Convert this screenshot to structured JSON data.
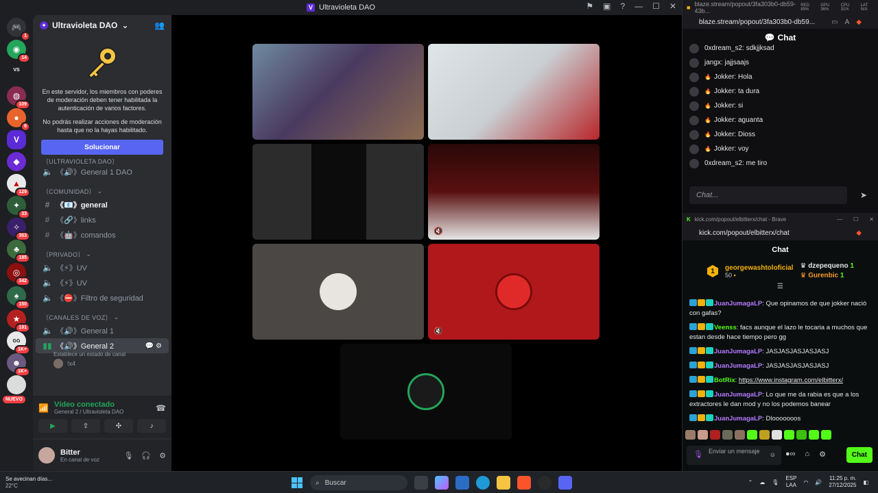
{
  "discord": {
    "window_title": "Ultravioleta DAO",
    "server_name": "Ultravioleta DAO",
    "guild_badges": [
      "1",
      "14",
      "109",
      "6",
      "129",
      "33",
      "353",
      "185",
      "342",
      "150",
      "191",
      "1K+",
      "1K+"
    ],
    "nuevo_label": "NUEVO",
    "mfa_text_1": "En este servidor, los miembros con poderes de moderación deben tener habilitada la autenticación de varios factores.",
    "mfa_text_2": "No podrás realizar acciones de moderación hasta que no la hayas habilitado.",
    "solve_button": "Solucionar",
    "categories": {
      "ultravioleta": "〔ULTRAVIOLETA DAO〕",
      "comunidad": "〔COMUNIDAD〕",
      "privado": "〔PRIVADO〕",
      "voz": "〔CANALES DE VOZ〕"
    },
    "channels": {
      "general1dao": "《🔊》General 1 DAO",
      "general": "《📧》general",
      "links": "《🔗》links",
      "comandos": "《🤖》comandos",
      "uv1": "《⚡》UV",
      "uv2": "《⚡》UV",
      "filtro": "《⛔》Filtro de seguridad",
      "general1": "《🔊》General 1",
      "general2": "《🔊》General 2"
    },
    "channel_status": "Establece un estado de canal",
    "voice_user": "!x4",
    "video_connected": "Vídeo conectado",
    "video_location": "General 2 / Ultravioleta DAO",
    "user_name": "Bitter",
    "user_status": "En canal de voz"
  },
  "blaze": {
    "tab_url": "blaze.stream/popout/3fa303b0-db59-43b...",
    "url": "blaze.stream/popout/3fa303b0-db59...",
    "stats": [
      "RED 85%",
      "GPU 36%",
      "CPU 31%",
      "LAT N/A"
    ],
    "chat_title": "Chat",
    "messages": [
      {
        "user": "0xdream_s2",
        "text": "sdkjjksad",
        "icon": ""
      },
      {
        "user": "jangx",
        "text": "jajjsaajs",
        "icon": ""
      },
      {
        "user": "Jokker",
        "text": "Hola",
        "icon": "🔥"
      },
      {
        "user": "Jokker",
        "text": "ta dura",
        "icon": "🔥"
      },
      {
        "user": "Jokker",
        "text": "si",
        "icon": "🔥"
      },
      {
        "user": "Jokker",
        "text": "aguanta",
        "icon": "🔥"
      },
      {
        "user": "Jokker",
        "text": "Dioss",
        "icon": "🔥"
      },
      {
        "user": "Jokker",
        "text": "voy",
        "icon": "🔥"
      },
      {
        "user": "0xdream_s2",
        "text": "me tiro",
        "icon": ""
      }
    ],
    "input_placeholder": "Chat..."
  },
  "kick": {
    "window_title": "kick.com/popout/elbitterx/chat - Brave",
    "url": "kick.com/popout/elbitterx/chat",
    "chat_title": "Chat",
    "leaderboard": {
      "top_rank": "1",
      "top_name": "georgewashtoloficial",
      "top_points": "50",
      "second_name": "dzepequeno",
      "second_points": "1",
      "third_name": "Gurenbic",
      "third_points": "1"
    },
    "messages": [
      {
        "user": "JuanJumagaLP",
        "color": "#b47cff",
        "text": "Que opinamos de que jokker nació con gafas?"
      },
      {
        "user": "Veenss",
        "color": "#53fc18",
        "text": "facs aunque el lazo le tocaria a muchos que estan desde hace tiempo pero gg"
      },
      {
        "user": "JuanJumagaLP",
        "color": "#b47cff",
        "text": "JASJASJASJASJASJ"
      },
      {
        "user": "JuanJumagaLP",
        "color": "#b47cff",
        "text": "JASJASJASJASJASJ"
      },
      {
        "user": "BotRix",
        "color": "#53fc18",
        "text": "https://www.instagram.com/elbitterx/"
      },
      {
        "user": "JuanJumagaLP",
        "color": "#b47cff",
        "text": "Lo que me da rabia es que a los extractores le dan mod y no los podemos banear"
      },
      {
        "user": "JuanJumagaLP",
        "color": "#b47cff",
        "text": "Dlooooooos"
      }
    ],
    "input_placeholder": "Enviar un mensaje",
    "send_label": "Chat"
  },
  "taskbar": {
    "weather_text": "Se avecinan días...",
    "weather_temp": "22°C",
    "search_label": "Buscar",
    "lang_1": "ESP",
    "lang_2": "LAA",
    "time": "11:25 p. m.",
    "date": "27/12/2025"
  }
}
